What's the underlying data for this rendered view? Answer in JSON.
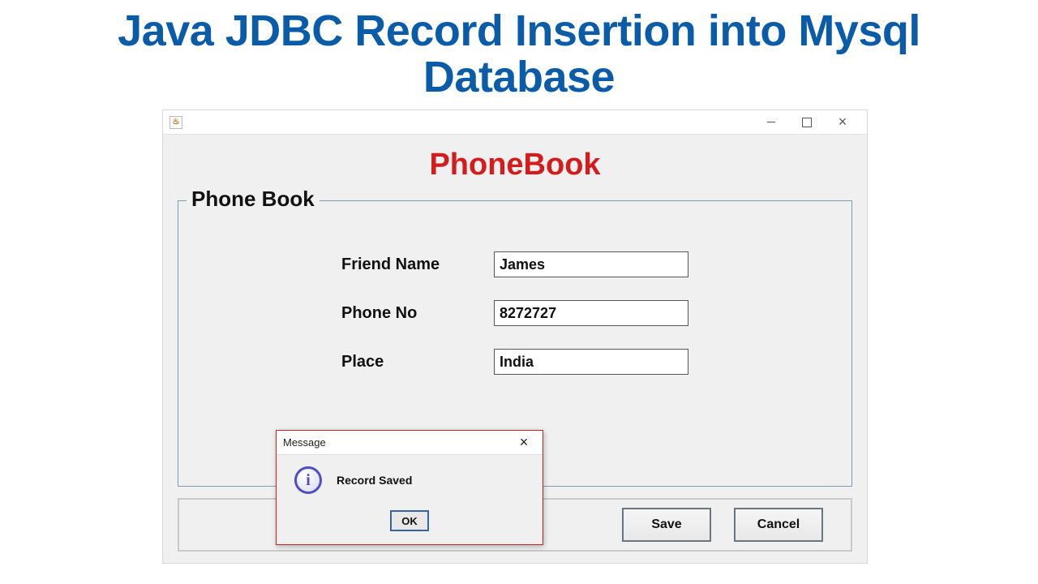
{
  "headline": "Java JDBC Record Insertion into Mysql Database",
  "window": {
    "title": "",
    "java_icon_glyph": "♨",
    "controls": {
      "min": "–",
      "max": "□",
      "close": "×"
    }
  },
  "app": {
    "title": "PhoneBook",
    "fieldset_legend": "Phone Book",
    "fields": {
      "friend_name": {
        "label": "Friend Name",
        "value": "James"
      },
      "phone_no": {
        "label": "Phone No",
        "value": "8272727"
      },
      "place": {
        "label": "Place",
        "value": "India"
      }
    },
    "buttons": {
      "save": "Save",
      "cancel": "Cancel"
    }
  },
  "dialog": {
    "title": "Message",
    "info_glyph": "i",
    "text": "Record Saved",
    "ok": "OK",
    "close": "×"
  }
}
